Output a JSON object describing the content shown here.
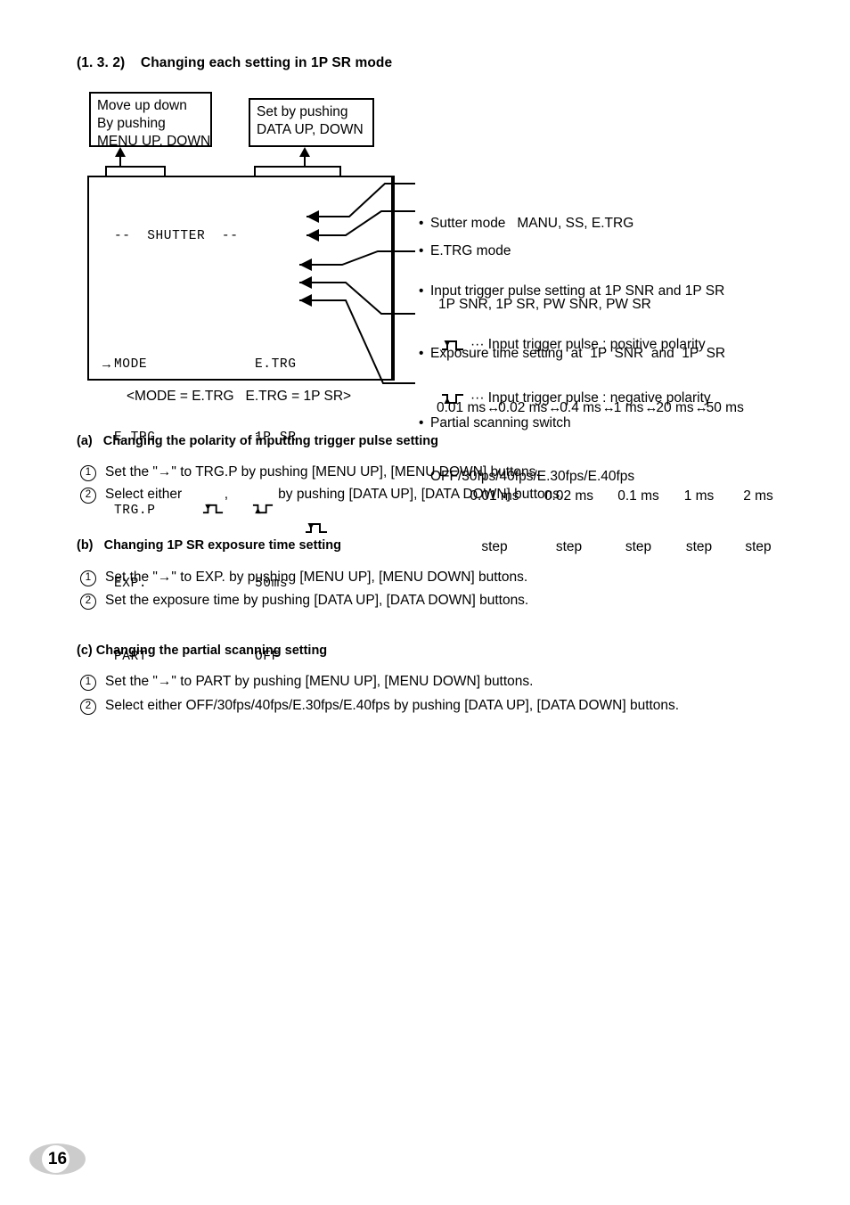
{
  "section": {
    "number": "(1. 3. 2)",
    "title": "Changing each setting in 1P SR mode",
    "heading": "(1. 3. 2)    Changing each setting in 1P SR mode"
  },
  "callouts": {
    "menu": {
      "line1": "Move up down",
      "line2": "By pushing",
      "line3": "MENU UP, DOWN",
      "text": "Move up down\nBy pushing\nMENU UP, DOWN"
    },
    "data": {
      "line1": "Set by pushing",
      "line2": "DATA UP, DOWN",
      "text": "Set by pushing\nDATA UP, DOWN"
    }
  },
  "screen": {
    "title": "--  SHUTTER  --",
    "cursor": "→",
    "rows": [
      {
        "label": "MODE",
        "value": "E.TRG"
      },
      {
        "label": "E.TRG",
        "value": "1P SR"
      },
      {
        "label": "TRG.P",
        "value": "pulse-positive"
      },
      {
        "label": "EXP.",
        "value": "50ms"
      },
      {
        "label": "PART",
        "value": "OFF"
      }
    ],
    "caption": "<MODE = E.TRG   E.TRG = 1P SR>"
  },
  "annotations": {
    "shutter_mode": {
      "line1": "Sutter mode   MANU, SS, E.TRG"
    },
    "etrg_mode": {
      "line1": "E.TRG mode",
      "line2": "1P SNR, 1P SR, PW SNR, PW SR"
    },
    "trigger_polarity": {
      "line1": "Input trigger pulse setting at 1P SNR and 1P SR",
      "positive": "··· Input trigger pulse : positive polarity",
      "negative": "··· Input trigger pulse : negative polarity"
    },
    "exposure": {
      "line1": "Exposure time setting  at  1P  SNR  and  1P  SR",
      "values": [
        "0.01 ms",
        "0.02 ms",
        "0.4 ms",
        "1 ms",
        "20 ms",
        "50 ms"
      ],
      "arrow": "↔",
      "steps": [
        {
          "value": "0.01 ms",
          "label": "step"
        },
        {
          "value": "0.02 ms",
          "label": "step"
        },
        {
          "value": "0.1 ms",
          "label": "step"
        },
        {
          "value": "1 ms",
          "label": "step"
        },
        {
          "value": "2 ms",
          "label": "step"
        }
      ]
    },
    "partial": {
      "line1": "Partial scanning switch",
      "line2": "OFF/30fps/40fps/E.30fps/E.40fps"
    }
  },
  "sections": {
    "a": {
      "heading": "(a)   Changing the polarity of inputting trigger pulse setting",
      "step1_num": "1",
      "step1": "Set the \"→\" to TRG.P by pushing [MENU UP], [MENU DOWN] buttons.",
      "step2_num": "2",
      "step2_pre": "Select either ",
      "step2_mid": ",  ",
      "step2_post": " by pushing [DATA UP], [DATA DOWN] buttons."
    },
    "b": {
      "heading": "(b)   Changing 1P SR exposure time setting",
      "step1_num": "1",
      "step1": "Set the \"→\" to EXP. by pushing [MENU UP], [MENU DOWN] buttons.",
      "step2_num": "2",
      "step2": "Set the exposure time by pushing [DATA UP], [DATA DOWN] buttons."
    },
    "c": {
      "heading": "(c) Changing the partial scanning setting",
      "step1_num": "1",
      "step1": "Set the \"→\" to PART by pushing [MENU UP], [MENU DOWN] buttons.",
      "step2_num": "2",
      "step2": "Select either OFF/30fps/40fps/E.30fps/E.40fps by pushing [DATA UP], [DATA DOWN] buttons."
    }
  },
  "footer": {
    "page_number": "16"
  },
  "colors": {
    "ink": "#000000",
    "page_badge": "#cccccc",
    "background": "#ffffff"
  }
}
